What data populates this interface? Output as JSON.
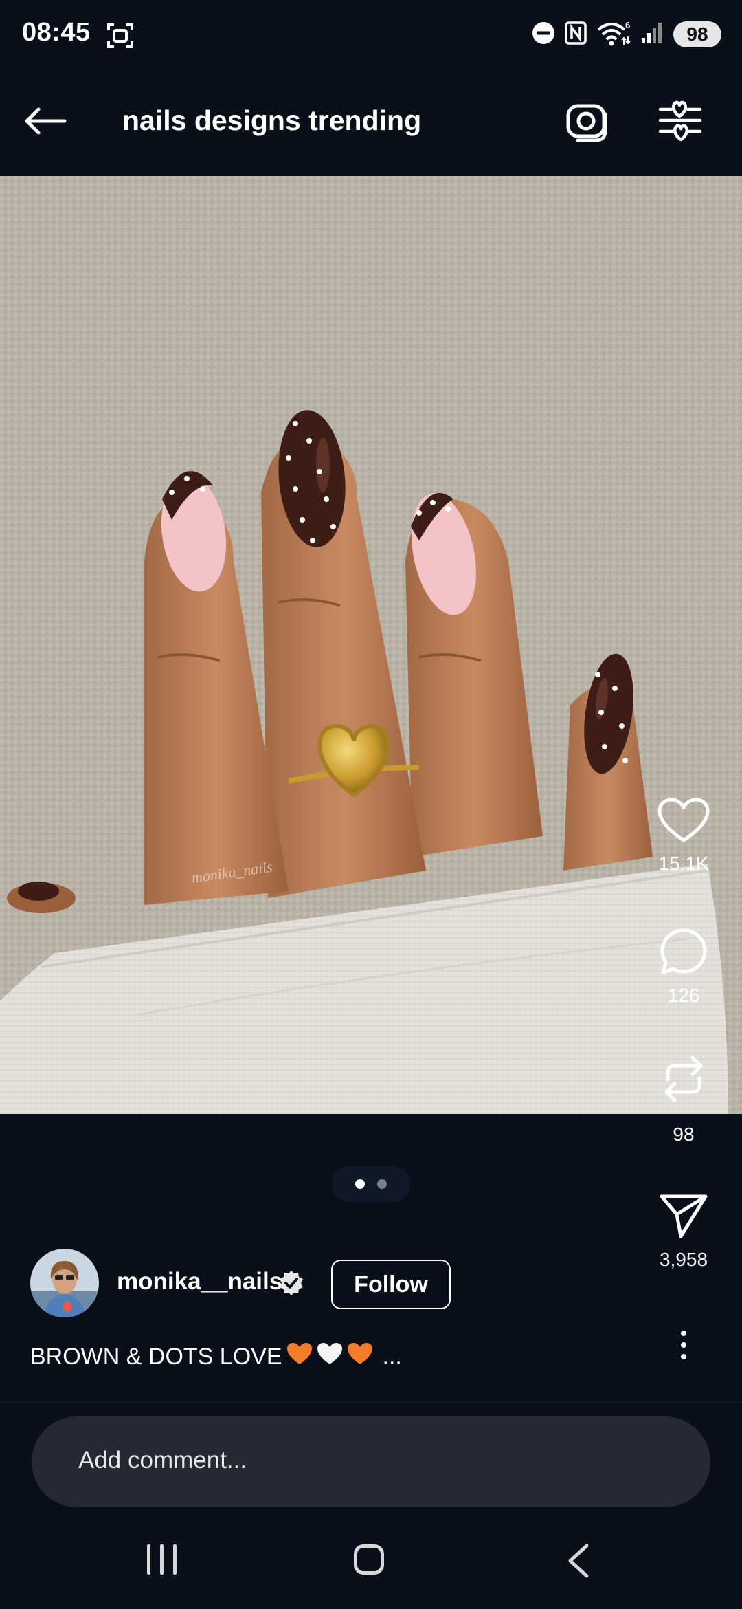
{
  "status_bar": {
    "time": "08:45",
    "icons": [
      "screenshot-icon",
      "do-not-disturb-icon",
      "nfc-icon",
      "wifi-6-icon",
      "signal-icon"
    ],
    "battery": "98"
  },
  "header": {
    "search_query": "nails designs trending",
    "icons": [
      "back-arrow-icon",
      "camera-icon",
      "filter-hearts-icon"
    ]
  },
  "post": {
    "image_watermark": "monika_nails",
    "carousel": {
      "total": 2,
      "active": 1
    },
    "actions": {
      "likes": "15.1K",
      "comments": "126",
      "reposts": "98",
      "shares": "3,958"
    },
    "author": {
      "username": "monika__nails",
      "verified": true,
      "follow_label": "Follow"
    },
    "caption": {
      "text": "BROWN & DOTS LOVE",
      "emojis": [
        "orange-heart",
        "white-heart",
        "orange-heart"
      ],
      "ellipsis": "..."
    }
  },
  "comment": {
    "placeholder": "Add comment..."
  },
  "nav": {
    "buttons": [
      "recents-icon",
      "home-icon",
      "back-icon"
    ]
  },
  "colors": {
    "background": "#0b0f19",
    "comment_bar": "#262932",
    "text": "#ffffff",
    "nail_brown": "#3d1d15",
    "nail_pink": "#f3c3c8"
  }
}
